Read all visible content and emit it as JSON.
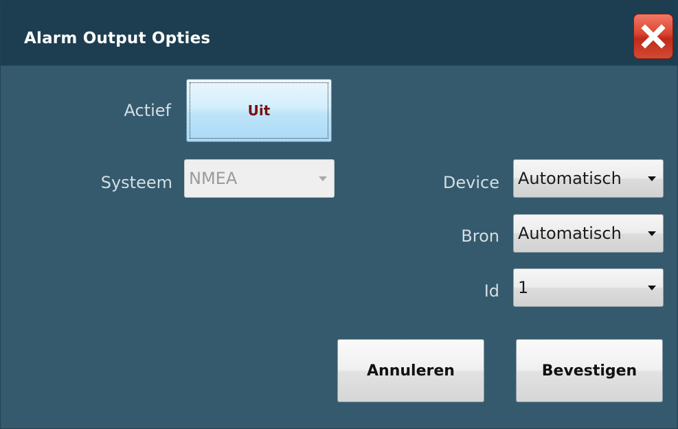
{
  "window": {
    "title": "Alarm Output Opties"
  },
  "form": {
    "actief": {
      "label": "Actief",
      "button_label": "Uit"
    },
    "systeem": {
      "label": "Systeem",
      "value": "NMEA",
      "enabled": false
    },
    "device": {
      "label": "Device",
      "value": "Automatisch"
    },
    "bron": {
      "label": "Bron",
      "value": "Automatisch"
    },
    "id": {
      "label": "Id",
      "value": "1"
    }
  },
  "buttons": {
    "cancel_label": "Annuleren",
    "confirm_label": "Bevestigen"
  },
  "colors": {
    "titlebar": "#1d3e50",
    "body": "#355a6d",
    "toggle_text": "#7a1010",
    "close_button": "#d8432f"
  }
}
